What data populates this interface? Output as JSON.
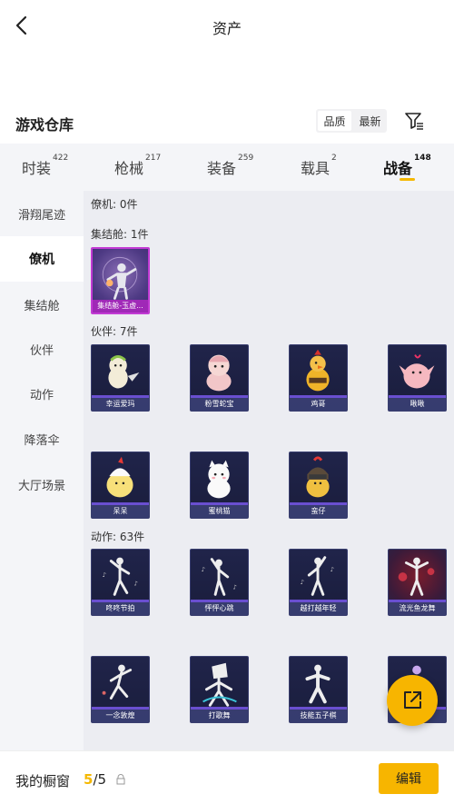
{
  "header": {
    "title": "资产"
  },
  "warehouse": {
    "title": "游戏仓库",
    "sort": [
      "品质",
      "最新"
    ]
  },
  "tabs": [
    {
      "label": "时装",
      "count": "422"
    },
    {
      "label": "枪械",
      "count": "217"
    },
    {
      "label": "装备",
      "count": "259"
    },
    {
      "label": "载具",
      "count": "2"
    },
    {
      "label": "战备",
      "count": "148"
    }
  ],
  "sidebar": [
    "滑翔尾迹",
    "僚机",
    "集结舱",
    "伙伴",
    "动作",
    "降落伞",
    "大厅场景"
  ],
  "groups": {
    "wingman": {
      "label": "僚机: 0件"
    },
    "pod": {
      "label": "集结舱: 1件",
      "items": [
        "集结舱-玉虚..."
      ]
    },
    "companion": {
      "label": "伙伴: 7件",
      "items": [
        "幸运爱玛",
        "粉雪蛇宝",
        "鸡哥",
        "啾啾",
        "呆呆",
        "蜜桃猫",
        "蛮仔"
      ]
    },
    "emote": {
      "label": "动作: 63件",
      "items": [
        "咚咚节拍",
        "怦怦心跳",
        "越打越年轻",
        "流光鱼龙舞",
        "一念敦煌",
        "打歌舞",
        "技能五子棋",
        ""
      ]
    }
  },
  "footer": {
    "label": "我的橱窗",
    "current": "5",
    "total": "/5",
    "edit": "编辑"
  },
  "colors": {
    "accent": "#f5b800",
    "card": "#20244a",
    "legendary": "#c23ad4"
  }
}
